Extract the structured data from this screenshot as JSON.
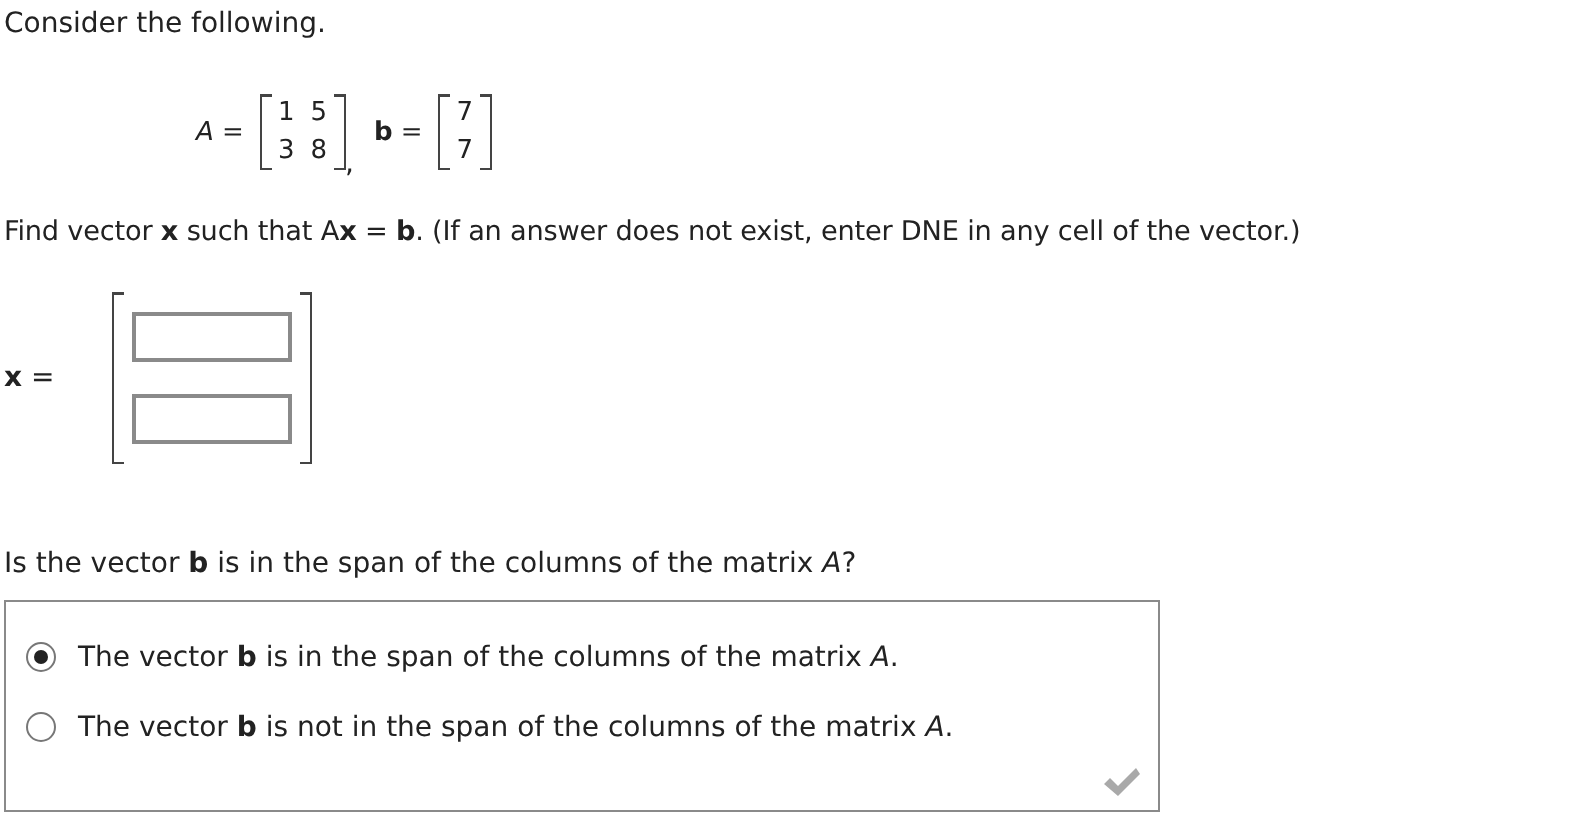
{
  "intro": "Consider the following.",
  "equation": {
    "matrix_label": "*A* =",
    "matrix": [
      [
        "1",
        "5"
      ],
      [
        "3",
        "8"
      ]
    ],
    "separator": ",",
    "vector_label": "**b** =",
    "vector": [
      "7",
      "7"
    ]
  },
  "instruction": "Find vector **x** such that A**x** = **b**. (If an answer does not exist, enter DNE in any cell of the vector.)",
  "answer": {
    "label": "**x** =",
    "fields": [
      {
        "kind": "input"
      },
      {
        "kind": "input"
      }
    ]
  },
  "question": "Is the vector **b** is in the span of the columns of the matrix *A*?",
  "options": [
    {
      "text": "The vector **b** is in the span of the columns of the matrix *A*.",
      "selected": true
    },
    {
      "text": "The vector **b** is not in the span of the columns of the matrix *A*.",
      "selected": false
    }
  ]
}
